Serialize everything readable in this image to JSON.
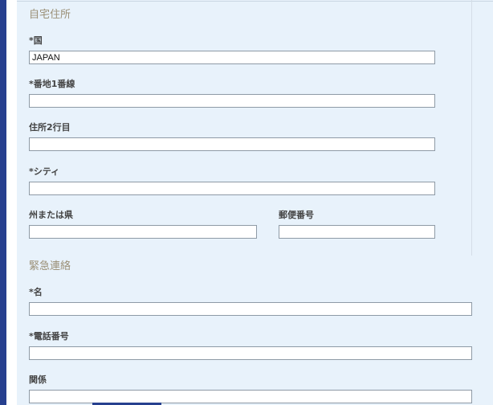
{
  "home_address": {
    "title": "自宅住所",
    "country": {
      "label": "*国",
      "value": "JAPAN"
    },
    "address1": {
      "label": "*番地1番線",
      "value": ""
    },
    "address2": {
      "label": "住所2行目",
      "value": ""
    },
    "city": {
      "label": "*シティ",
      "value": ""
    },
    "state": {
      "label": "州または県",
      "value": ""
    },
    "postal": {
      "label": "郵便番号",
      "value": ""
    }
  },
  "emergency_contact": {
    "title": "緊急連絡",
    "name": {
      "label": "*名",
      "value": ""
    },
    "phone": {
      "label": "*電話番号",
      "value": ""
    },
    "relation": {
      "label": "関係",
      "value": ""
    }
  },
  "colors": {
    "sidebar": "#27408f",
    "panel": "#e8f2fb",
    "section_title": "#9b9077",
    "field_border": "#8e9aa6"
  }
}
